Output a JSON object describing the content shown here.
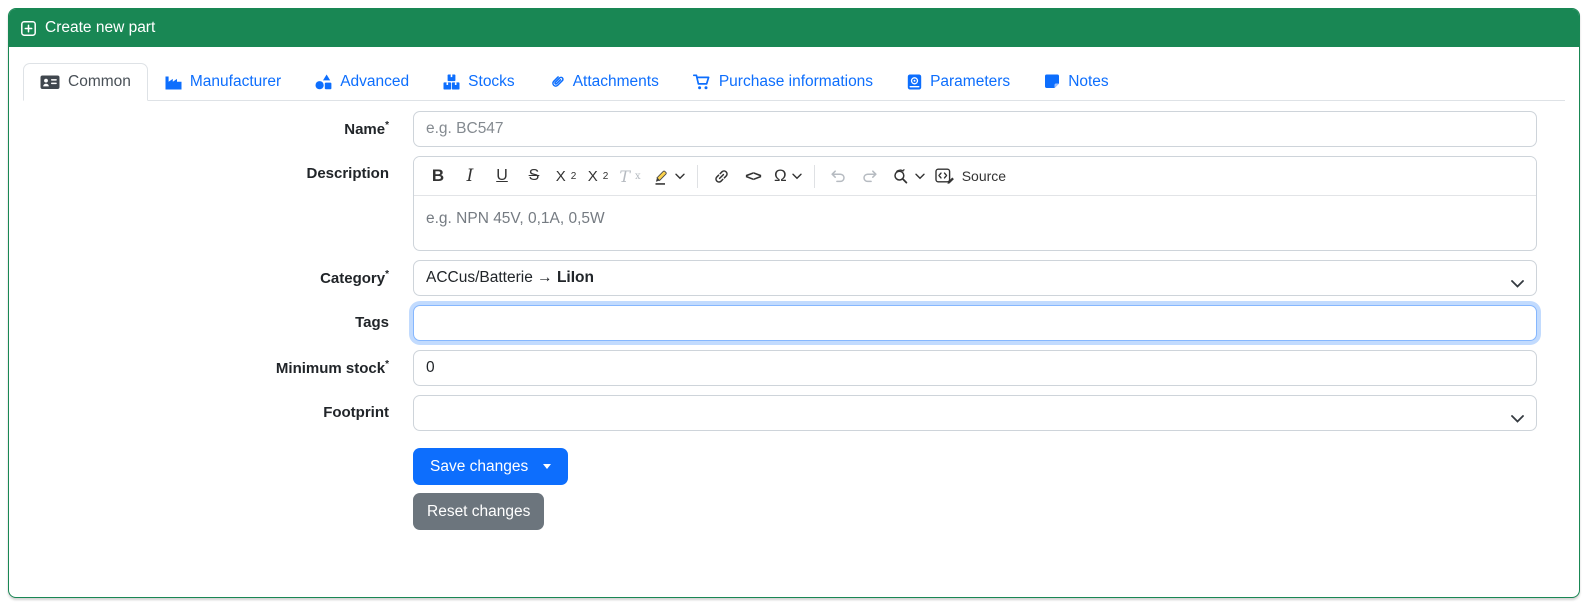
{
  "window": {
    "title": "Create new part"
  },
  "theme": {
    "header_green": "#198754",
    "accent_blue": "#0d6efd",
    "secondary_gray": "#6c757d",
    "active_tab_text": "#495057",
    "focus_ring_blue": "#86b7fe",
    "card_border": "#198754"
  },
  "icons": {
    "header": "plus-square-icon",
    "tabs": [
      "address-card-icon",
      "factory-icon",
      "shapes-icon",
      "boxes-stacked-icon",
      "paperclip-icon",
      "shopping-cart-icon",
      "book-atlas-icon",
      "sticky-note-icon"
    ],
    "toolbar": [
      "bold",
      "italic",
      "underline",
      "strikethrough",
      "subscript",
      "superscript",
      "remove-format",
      "highlight-pen",
      "link",
      "code",
      "special-characters",
      "undo",
      "redo",
      "find-replace",
      "source"
    ],
    "select_chevron": "chevron-down-icon",
    "save_caret": "caret-down-icon"
  },
  "tabs": [
    {
      "label": "Common",
      "active": true
    },
    {
      "label": "Manufacturer",
      "active": false
    },
    {
      "label": "Advanced",
      "active": false
    },
    {
      "label": "Stocks",
      "active": false
    },
    {
      "label": "Attachments",
      "active": false
    },
    {
      "label": "Purchase informations",
      "active": false
    },
    {
      "label": "Parameters",
      "active": false
    },
    {
      "label": "Notes",
      "active": false
    }
  ],
  "form": {
    "required_marker": "*",
    "name": {
      "label": "Name",
      "placeholder": "e.g. BC547",
      "value": ""
    },
    "description": {
      "label": "Description",
      "placeholder": "e.g. NPN 45V, 0,1A, 0,5W",
      "value": ""
    },
    "category": {
      "label": "Category",
      "value_path": "ACCus/Batterie → ",
      "value_name": "LiIon"
    },
    "tags": {
      "label": "Tags",
      "value": ""
    },
    "minimum_stock": {
      "label": "Minimum stock",
      "value": "0"
    },
    "footprint": {
      "label": "Footprint",
      "value": ""
    },
    "buttons": {
      "save_label": "Save changes",
      "reset_label": "Reset changes"
    }
  },
  "editor_toolbar": {
    "bold": "B",
    "italic": "I",
    "underline": "U",
    "strikethrough": "S",
    "script_base": "X",
    "script_small": "2",
    "remove_format_base": "T",
    "remove_format_small": "x",
    "code": "<>",
    "special_characters": "Ω",
    "source_label": "Source"
  }
}
